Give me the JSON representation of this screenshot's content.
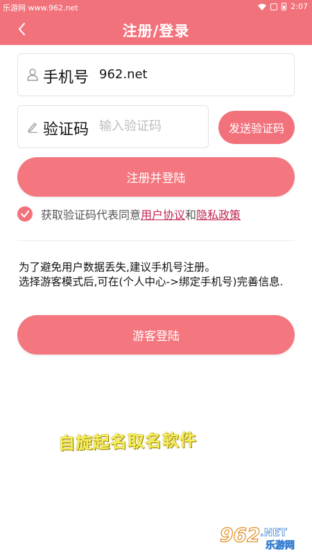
{
  "status_bar": {
    "carrier_text": "乐游网 www.962.net",
    "time": "2:07"
  },
  "header": {
    "title": "注册/登录",
    "back_icon": "chevron-left-icon"
  },
  "phone_field": {
    "icon": "user-icon",
    "label": "手机号",
    "value": "962.net"
  },
  "code_field": {
    "icon": "pencil-icon",
    "label": "验证码",
    "placeholder": "输入验证码"
  },
  "send_code_button": "发送验证码",
  "register_button": "注册并登陆",
  "agreement": {
    "prefix": "获取验证码代表同意",
    "user_agreement": "用户协议",
    "conjunction": "和",
    "privacy_policy": "隐私政策",
    "checked": true
  },
  "notice": {
    "line1": "为了避免用户数据丢失,建议手机号注册。",
    "line2": "选择游客模式后,可在(个人中心->绑定手机号)完善信息."
  },
  "guest_button": "游客登陆",
  "overlay_text": "自旋起名取名软件",
  "logo": {
    "number": "962",
    "suffix": ".NET",
    "name": "乐游网"
  },
  "colors": {
    "accent": "#f2727c",
    "link": "#c1244f"
  }
}
